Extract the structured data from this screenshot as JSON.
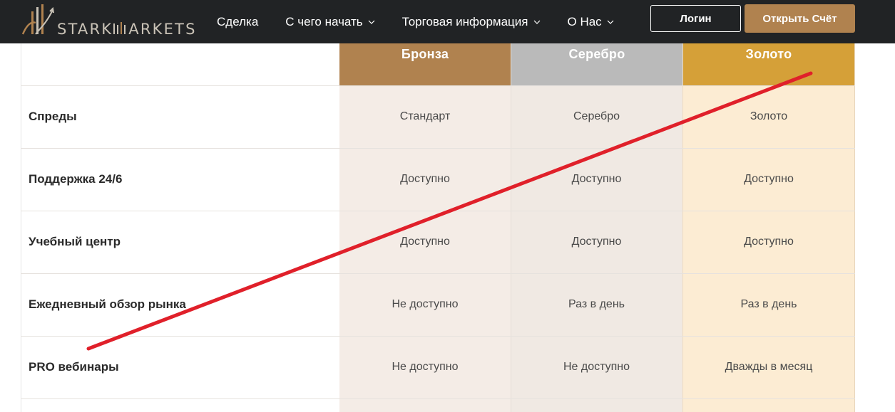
{
  "header": {
    "logo": {
      "text_left": "STARK",
      "text_right": "ARKETS"
    },
    "nav": [
      {
        "label": "Сделка",
        "dropdown": false
      },
      {
        "label": "С чего начать",
        "dropdown": true
      },
      {
        "label": "Торговая информация",
        "dropdown": true
      },
      {
        "label": "О Нас",
        "dropdown": true
      }
    ],
    "login_label": "Логин",
    "open_account_label": "Открыть Счёт"
  },
  "table": {
    "tiers": [
      "Бронза",
      "Серебро",
      "Золото"
    ],
    "rows": [
      {
        "label": "Спреды",
        "values": [
          "Стандарт",
          "Серебро",
          "Золото"
        ]
      },
      {
        "label": "Поддержка 24/6",
        "values": [
          "Доступно",
          "Доступно",
          "Доступно"
        ]
      },
      {
        "label": "Учебный центр",
        "values": [
          "Доступно",
          "Доступно",
          "Доступно"
        ]
      },
      {
        "label": "Ежедневный обзор рынка",
        "values": [
          "Не доступно",
          "Раз в день",
          "Раз в день"
        ]
      },
      {
        "label": "PRO вебинары",
        "values": [
          "Не доступно",
          "Не доступно",
          "Дважды в месяц"
        ]
      }
    ]
  },
  "colors": {
    "header_bg": "#212325",
    "accent": "#b0824f",
    "bronze": "#b0824f",
    "silver": "#bababa",
    "gold": "#d5a038",
    "strike_line": "#e0202a"
  }
}
